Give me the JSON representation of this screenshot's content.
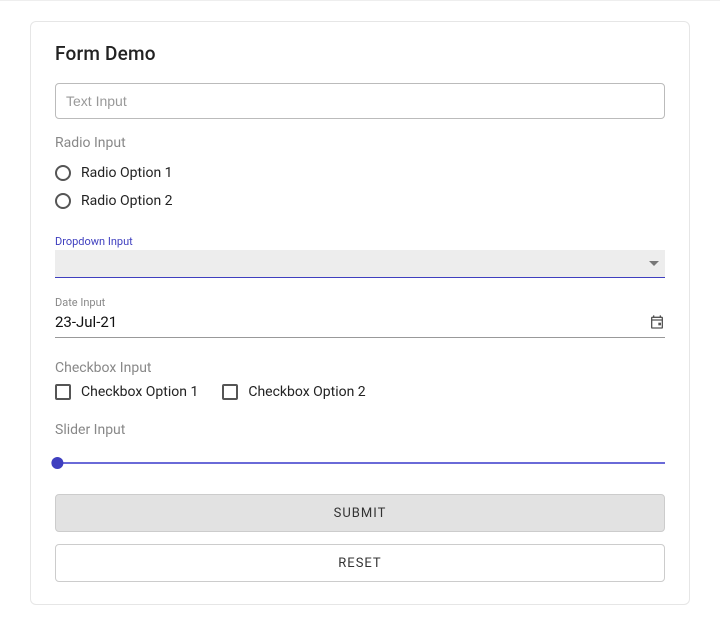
{
  "title": "Form Demo",
  "textInput": {
    "placeholder": "Text Input",
    "value": ""
  },
  "radio": {
    "label": "Radio Input",
    "options": [
      "Radio Option 1",
      "Radio Option 2"
    ]
  },
  "dropdown": {
    "label": "Dropdown Input",
    "selected": ""
  },
  "date": {
    "label": "Date Input",
    "value": "23-Jul-21"
  },
  "checkbox": {
    "label": "Checkbox Input",
    "options": [
      "Checkbox Option 1",
      "Checkbox Option 2"
    ]
  },
  "slider": {
    "label": "Slider Input"
  },
  "buttons": {
    "submit": "SUBMIT",
    "reset": "RESET"
  }
}
